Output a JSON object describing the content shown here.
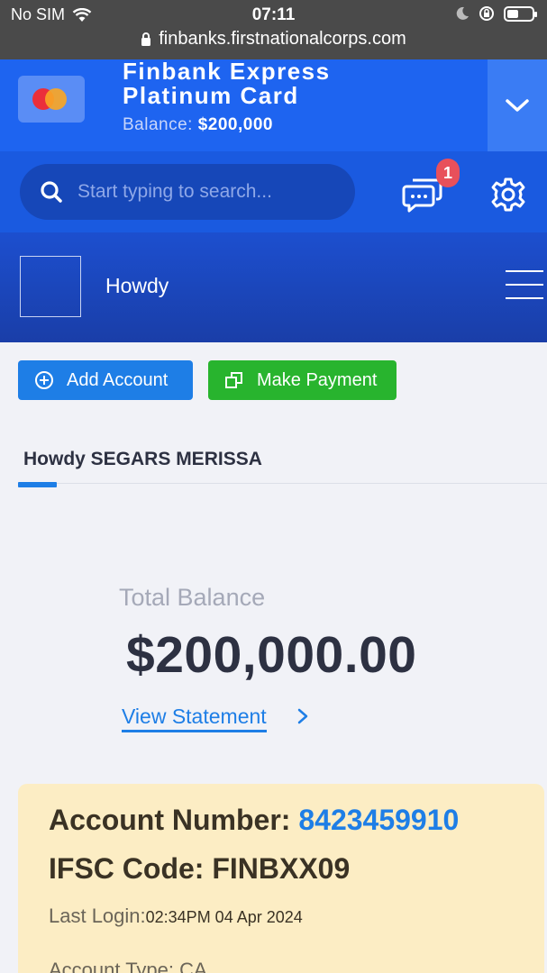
{
  "status_bar": {
    "carrier": "No SIM",
    "time": "07:11",
    "url": "finbanks.firstnationalcorps.com"
  },
  "card": {
    "title_line1": "Finbank Express",
    "title_line2": "Platinum Card",
    "balance_label": "Balance:",
    "balance_value": "$200,000"
  },
  "search": {
    "placeholder": "Start typing to search..."
  },
  "notifications": {
    "count": "1"
  },
  "greeting": {
    "text": "Howdy"
  },
  "actions": {
    "add_account": "Add Account",
    "make_payment": "Make Payment"
  },
  "tab": {
    "label": "Howdy SEGARS MERISSA"
  },
  "balance": {
    "label": "Total Balance",
    "value": "$200,000.00",
    "statement_link": "View Statement"
  },
  "account": {
    "number_label": "Account Number:",
    "number_value": "8423459910",
    "ifsc_label": "IFSC Code:",
    "ifsc_value": "FINBXX09",
    "last_login_label": "Last Login:",
    "last_login_value": "02:34PM 04 Apr 2024",
    "type_label": "Account Type:",
    "type_value": "CA"
  },
  "colors": {
    "primary": "#1e64f0",
    "accent_blue": "#1e7ee6",
    "green": "#28b42e",
    "badge_red": "#e8505b",
    "account_card_bg": "#fcedc4"
  }
}
